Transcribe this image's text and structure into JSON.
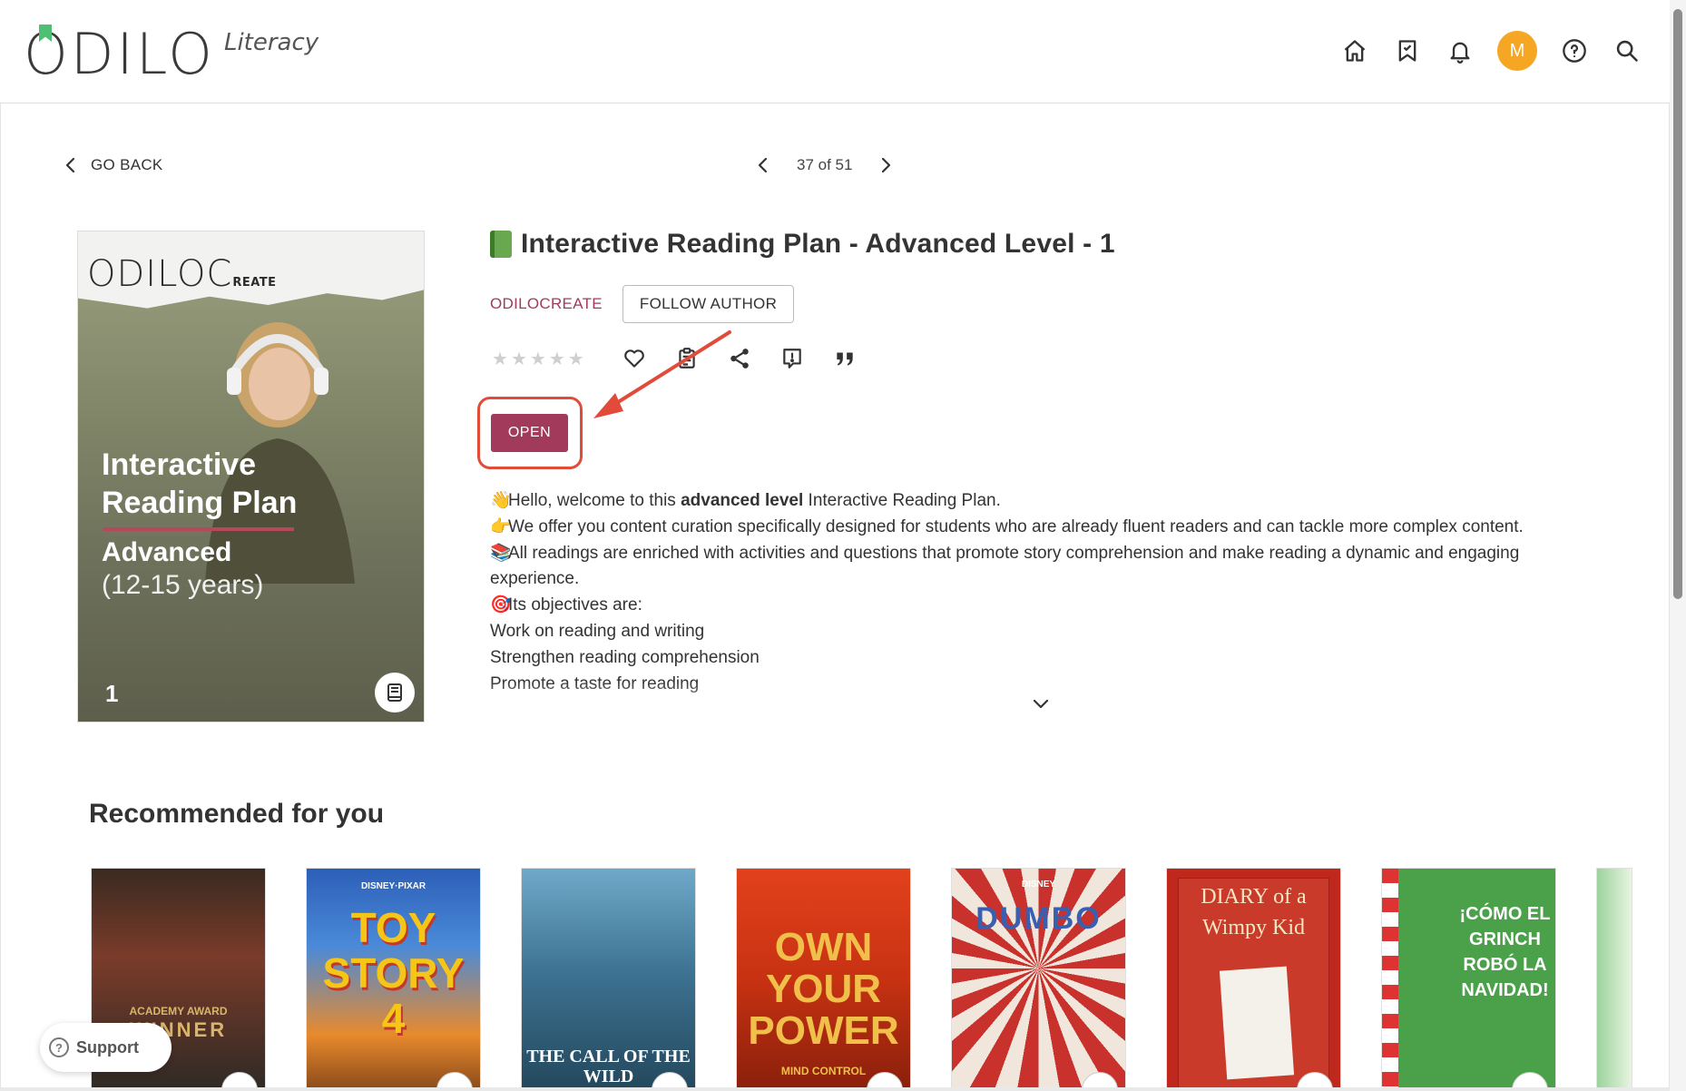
{
  "app": {
    "logo_text": "ODILO",
    "logo_subtitle": "Literacy",
    "avatar_initial": "M",
    "accent_color": "#a23b5b",
    "avatar_color": "#f5a623"
  },
  "header_icons": [
    "home-icon",
    "bookmark-list-icon",
    "bell-icon",
    "avatar",
    "help-icon",
    "search-icon"
  ],
  "nav": {
    "go_back_label": "GO BACK",
    "pager_text": "37 of 51"
  },
  "cover": {
    "logo_text": "ODILOC",
    "logo_suffix": "REATE",
    "title_line1": "Interactive",
    "title_line2": "Reading Plan",
    "level": "Advanced",
    "age": "(12-15 years)",
    "number": "1"
  },
  "book": {
    "title": "Interactive Reading Plan - Advanced Level - 1",
    "author": "ODILOCREATE",
    "follow_label": "FOLLOW AUTHOR",
    "rating_stars": 5,
    "rating_value": 0,
    "open_label": "OPEN"
  },
  "description": {
    "line1_pre": "Hello, welcome to this ",
    "line1_bold": "advanced level",
    "line1_post": " Interactive Reading Plan.",
    "line2": "We offer you content curation specifically designed for students who are already fluent readers and can tackle more complex content.",
    "line3": "All readings are enriched with activities and questions that promote story comprehension and make reading a dynamic and engaging experience.",
    "line4": "Its objectives are:",
    "line5": "Work on reading and writing",
    "line6": "Strengthen reading comprehension",
    "line7": "Promote a taste for reading"
  },
  "recommended": {
    "title": "Recommended for you",
    "items": [
      {
        "label": "WINNER",
        "sub": "ACADEMY AWARD"
      },
      {
        "label": "TOY STORY 4",
        "sub": "DISNEY·PIXAR"
      },
      {
        "label": "THE CALL OF THE WILD",
        "sub": ""
      },
      {
        "label": "OWN YOUR POWER",
        "sub": "MIND CONTROL"
      },
      {
        "label": "DUMBO",
        "sub": "DISNEY"
      },
      {
        "label": "DIARY of a Wimpy Kid",
        "sub": ""
      },
      {
        "label": "¡CÓMO EL GRINCH ROBÓ LA NAVIDAD!",
        "sub": ""
      }
    ]
  },
  "support_label": "Support"
}
